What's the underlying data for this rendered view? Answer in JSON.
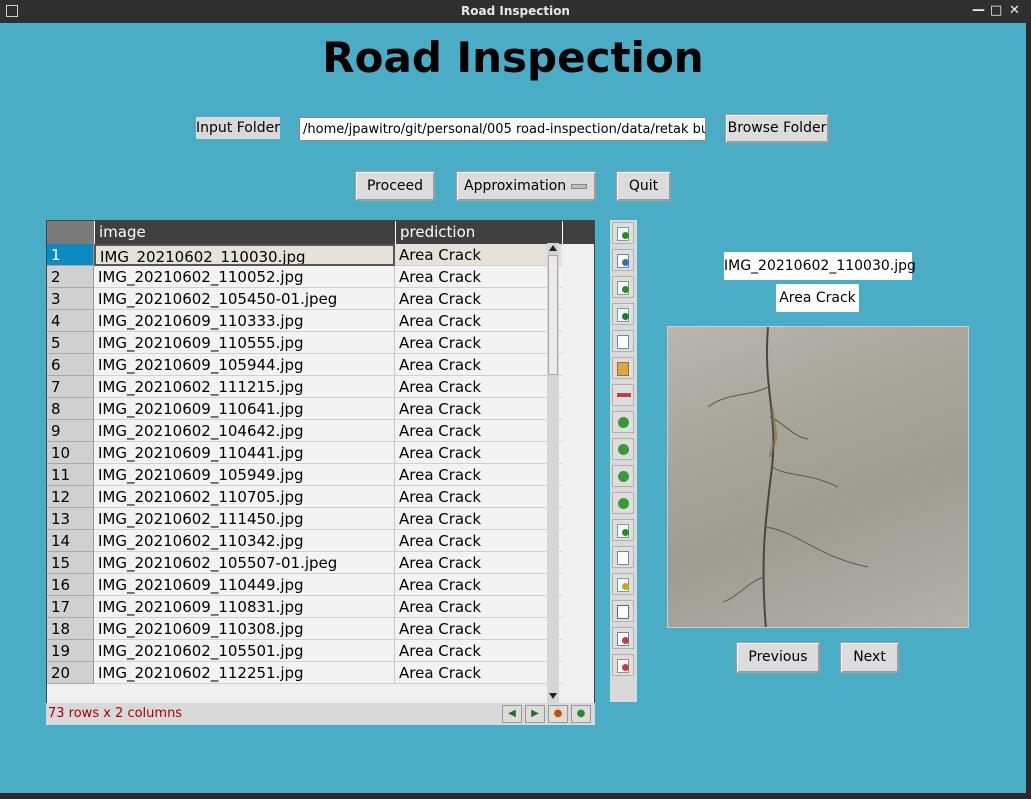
{
  "window": {
    "title": "Road Inspection",
    "controls": [
      "minimize",
      "maximize",
      "close"
    ]
  },
  "header": {
    "title": "Road Inspection"
  },
  "input": {
    "label": "Input Folder",
    "path": "/home/jpawitro/git/personal/005 road-inspection/data/retak bu",
    "browse_label": "Browse Folder"
  },
  "actions": {
    "proceed_label": "Proceed",
    "method_selected": "Approximation",
    "quit_label": "Quit"
  },
  "table": {
    "columns": [
      "image",
      "prediction"
    ],
    "rows": [
      {
        "idx": "1",
        "image": "IMG_20210602_110030.jpg",
        "prediction": "Area Crack"
      },
      {
        "idx": "2",
        "image": "IMG_20210602_110052.jpg",
        "prediction": "Area Crack"
      },
      {
        "idx": "3",
        "image": "IMG_20210602_105450-01.jpeg",
        "prediction": "Area Crack"
      },
      {
        "idx": "4",
        "image": "IMG_20210609_110333.jpg",
        "prediction": "Area Crack"
      },
      {
        "idx": "5",
        "image": "IMG_20210609_110555.jpg",
        "prediction": "Area Crack"
      },
      {
        "idx": "6",
        "image": "IMG_20210609_105944.jpg",
        "prediction": "Area Crack"
      },
      {
        "idx": "7",
        "image": "IMG_20210602_111215.jpg",
        "prediction": "Area Crack"
      },
      {
        "idx": "8",
        "image": "IMG_20210609_110641.jpg",
        "prediction": "Area Crack"
      },
      {
        "idx": "9",
        "image": "IMG_20210602_104642.jpg",
        "prediction": "Area Crack"
      },
      {
        "idx": "10",
        "image": "IMG_20210609_110441.jpg",
        "prediction": "Area Crack"
      },
      {
        "idx": "11",
        "image": "IMG_20210609_105949.jpg",
        "prediction": "Area Crack"
      },
      {
        "idx": "12",
        "image": "IMG_20210602_110705.jpg",
        "prediction": "Area Crack"
      },
      {
        "idx": "13",
        "image": "IMG_20210602_111450.jpg",
        "prediction": "Area Crack"
      },
      {
        "idx": "14",
        "image": "IMG_20210602_110342.jpg",
        "prediction": "Area Crack"
      },
      {
        "idx": "15",
        "image": "IMG_20210602_105507-01.jpeg",
        "prediction": "Area Crack"
      },
      {
        "idx": "16",
        "image": "IMG_20210609_110449.jpg",
        "prediction": "Area Crack"
      },
      {
        "idx": "17",
        "image": "IMG_20210609_110831.jpg",
        "prediction": "Area Crack"
      },
      {
        "idx": "18",
        "image": "IMG_20210609_110308.jpg",
        "prediction": "Area Crack"
      },
      {
        "idx": "19",
        "image": "IMG_20210602_105501.jpg",
        "prediction": "Area Crack"
      },
      {
        "idx": "20",
        "image": "IMG_20210602_112251.jpg",
        "prediction": "Area Crack"
      }
    ],
    "status": "73 rows x 2 columns",
    "selected_row": "1"
  },
  "preview": {
    "filename": "IMG_20210602_110030.jpg",
    "prediction": "Area Crack",
    "previous_label": "Previous",
    "next_label": "Next"
  },
  "colors": {
    "window_bg": "#4bacc6",
    "table_header": "#404040",
    "selection": "#0c8ac4",
    "status_text": "#aa0000"
  }
}
